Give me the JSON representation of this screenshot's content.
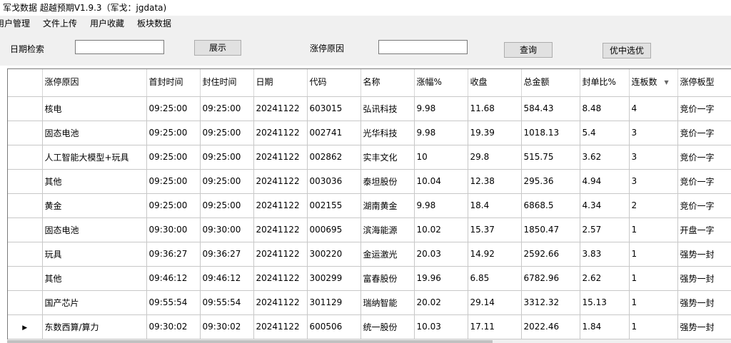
{
  "window": {
    "title": "军戈数据 超越预期V1.9.3（军戈：jgdata)"
  },
  "menu": [
    "用户管理",
    "文件上传",
    "用户收藏",
    "板块数据"
  ],
  "toolbar": {
    "date_label": "日期检索",
    "date_value": "",
    "show_button": "展示",
    "reason_label": "涨停原因",
    "reason_value": "",
    "query_button": "查询",
    "pick_button": "优中选优"
  },
  "table": {
    "columns": [
      "涨停原因",
      "首封时间",
      "封住时间",
      "日期",
      "代码",
      "名称",
      "涨幅%",
      "收盘",
      "总金额",
      "封单比%",
      "连板数",
      "涨停板型"
    ],
    "sorted_column": "连板数",
    "current_row_index": 9,
    "rows": [
      [
        "核电",
        "09:25:00",
        "09:25:00",
        "20241122",
        "603015",
        "弘讯科技",
        "9.98",
        "11.68",
        "584.43",
        "8.48",
        "4",
        "竞价一字"
      ],
      [
        "固态电池",
        "09:25:00",
        "09:25:00",
        "20241122",
        "002741",
        "光华科技",
        "9.98",
        "19.39",
        "1018.13",
        "5.4",
        "3",
        "竞价一字"
      ],
      [
        "人工智能大模型+玩具",
        "09:25:00",
        "09:25:00",
        "20241122",
        "002862",
        "实丰文化",
        "10",
        "29.8",
        "515.75",
        "3.62",
        "3",
        "竞价一字"
      ],
      [
        "其他",
        "09:25:00",
        "09:25:00",
        "20241122",
        "003036",
        "泰坦股份",
        "10.04",
        "12.38",
        "295.36",
        "4.94",
        "3",
        "竞价一字"
      ],
      [
        "黄金",
        "09:25:00",
        "09:25:00",
        "20241122",
        "002155",
        "湖南黄金",
        "9.98",
        "18.4",
        "6868.5",
        "4.34",
        "2",
        "竞价一字"
      ],
      [
        "固态电池",
        "09:30:00",
        "09:30:00",
        "20241122",
        "000695",
        "滨海能源",
        "10.02",
        "15.37",
        "1850.47",
        "2.57",
        "1",
        "开盘一字"
      ],
      [
        "玩具",
        "09:36:27",
        "09:36:27",
        "20241122",
        "300220",
        "金运激光",
        "20.03",
        "14.92",
        "2592.66",
        "3.83",
        "1",
        "强势一封"
      ],
      [
        "其他",
        "09:46:12",
        "09:46:12",
        "20241122",
        "300299",
        "富春股份",
        "19.96",
        "6.85",
        "6782.96",
        "2.62",
        "1",
        "强势一封"
      ],
      [
        "国产芯片",
        "09:55:54",
        "09:55:54",
        "20241122",
        "301129",
        "瑞纳智能",
        "20.02",
        "29.14",
        "3312.32",
        "15.13",
        "1",
        "强势一封"
      ],
      [
        "东数西算/算力",
        "09:30:02",
        "09:30:02",
        "20241122",
        "600506",
        "统一股份",
        "10.03",
        "17.11",
        "2022.46",
        "1.84",
        "1",
        "强势一封"
      ]
    ]
  }
}
